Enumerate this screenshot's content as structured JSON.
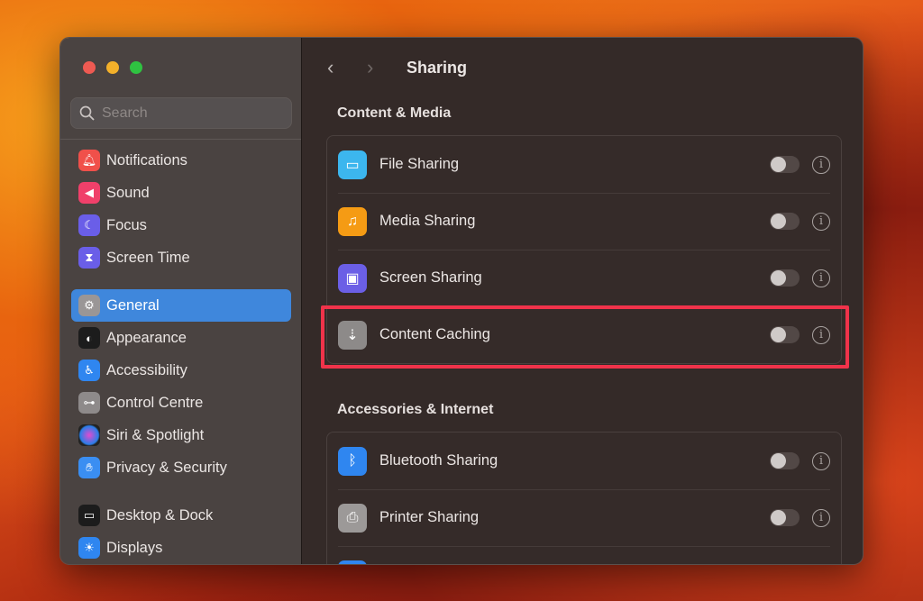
{
  "search": {
    "placeholder": "Search"
  },
  "sidebar": {
    "items": [
      {
        "label": "Notifications",
        "icon": "bell-icon",
        "color": "#f0504a"
      },
      {
        "label": "Sound",
        "icon": "speaker-icon",
        "color": "#f0406a"
      },
      {
        "label": "Focus",
        "icon": "moon-icon",
        "color": "#6a5ee8"
      },
      {
        "label": "Screen Time",
        "icon": "hourglass-icon",
        "color": "#6a5ee8"
      },
      {
        "label": "General",
        "icon": "gear-icon",
        "color": "#9a9696",
        "selected": true
      },
      {
        "label": "Appearance",
        "icon": "appearance-icon",
        "color": "#1c1c1c"
      },
      {
        "label": "Accessibility",
        "icon": "accessibility-icon",
        "color": "#2f86f0"
      },
      {
        "label": "Control Centre",
        "icon": "toggles-icon",
        "color": "#8e8a8a"
      },
      {
        "label": "Siri & Spotlight",
        "icon": "siri-icon",
        "color": "#333"
      },
      {
        "label": "Privacy & Security",
        "icon": "hand-icon",
        "color": "#3a8ef2"
      },
      {
        "label": "Desktop & Dock",
        "icon": "dock-icon",
        "color": "#1c1c1c"
      },
      {
        "label": "Displays",
        "icon": "sun-icon",
        "color": "#2f86f0"
      }
    ]
  },
  "header": {
    "title": "Sharing"
  },
  "sections": [
    {
      "title": "Content & Media",
      "rows": [
        {
          "label": "File Sharing",
          "icon": "folder-icon",
          "color": "#3cb6ee",
          "on": false
        },
        {
          "label": "Media Sharing",
          "icon": "music-icon",
          "color": "#f59b14",
          "on": false
        },
        {
          "label": "Screen Sharing",
          "icon": "screen-share-icon",
          "color": "#6b5fe6",
          "on": false
        },
        {
          "label": "Content Caching",
          "icon": "download-icon",
          "color": "#8d8a89",
          "on": false
        }
      ]
    },
    {
      "title": "Accessories & Internet",
      "rows": [
        {
          "label": "Bluetooth Sharing",
          "icon": "bluetooth-icon",
          "color": "#2f86f0",
          "on": false
        },
        {
          "label": "Printer Sharing",
          "icon": "printer-icon",
          "color": "#9c9998",
          "on": false
        }
      ]
    }
  ]
}
